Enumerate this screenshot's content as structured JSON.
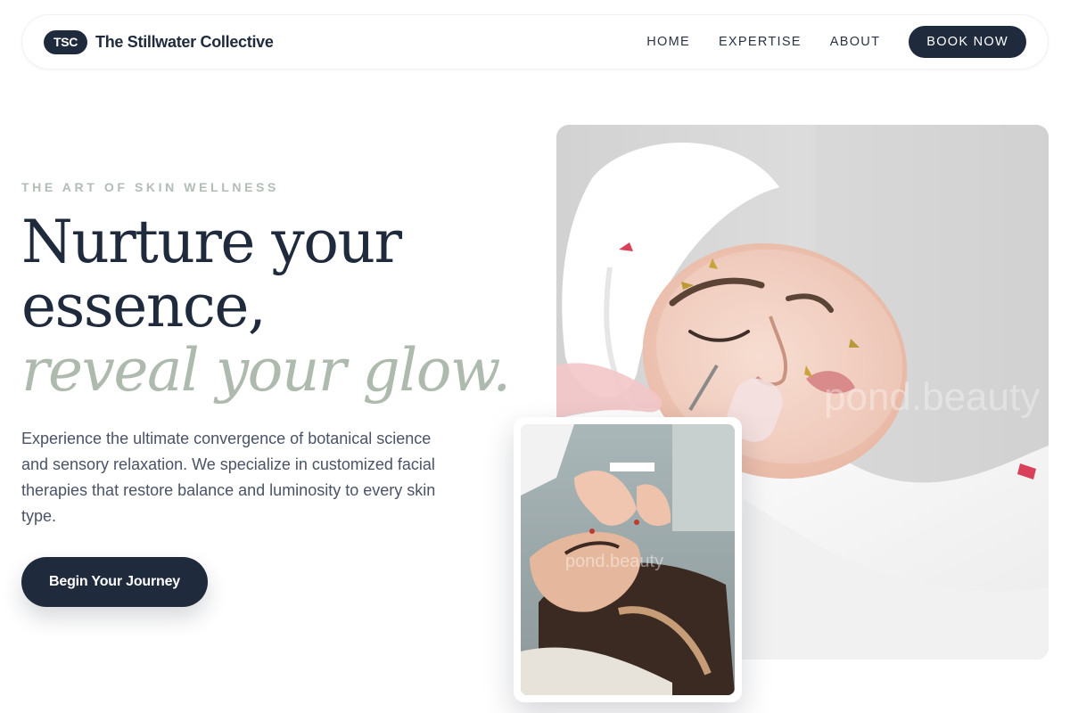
{
  "brand": {
    "logo_text": "TSC",
    "name": "The Stillwater Collective"
  },
  "nav": {
    "links": [
      "HOME",
      "EXPERTISE",
      "ABOUT"
    ],
    "cta": "BOOK NOW"
  },
  "hero": {
    "eyebrow": "THE ART OF SKIN WELLNESS",
    "headline_line1": "Nurture your",
    "headline_line2": "essence,",
    "headline_accent": "reveal your glow.",
    "lead": "Experience the ultimate convergence of botanical science and sensory relaxation. We specialize in customized facial therapies that restore balance and luminosity to every skin type.",
    "cta": "Begin Your Journey"
  },
  "images": {
    "main_watermark": "pond.beauty",
    "inset_watermark": "pond.beauty"
  },
  "colors": {
    "primary": "#1f2a3c",
    "accent_sage": "#aebaae",
    "eyebrow": "#b2bdb6",
    "body_text": "#4a5366",
    "background": "#ffffff"
  }
}
